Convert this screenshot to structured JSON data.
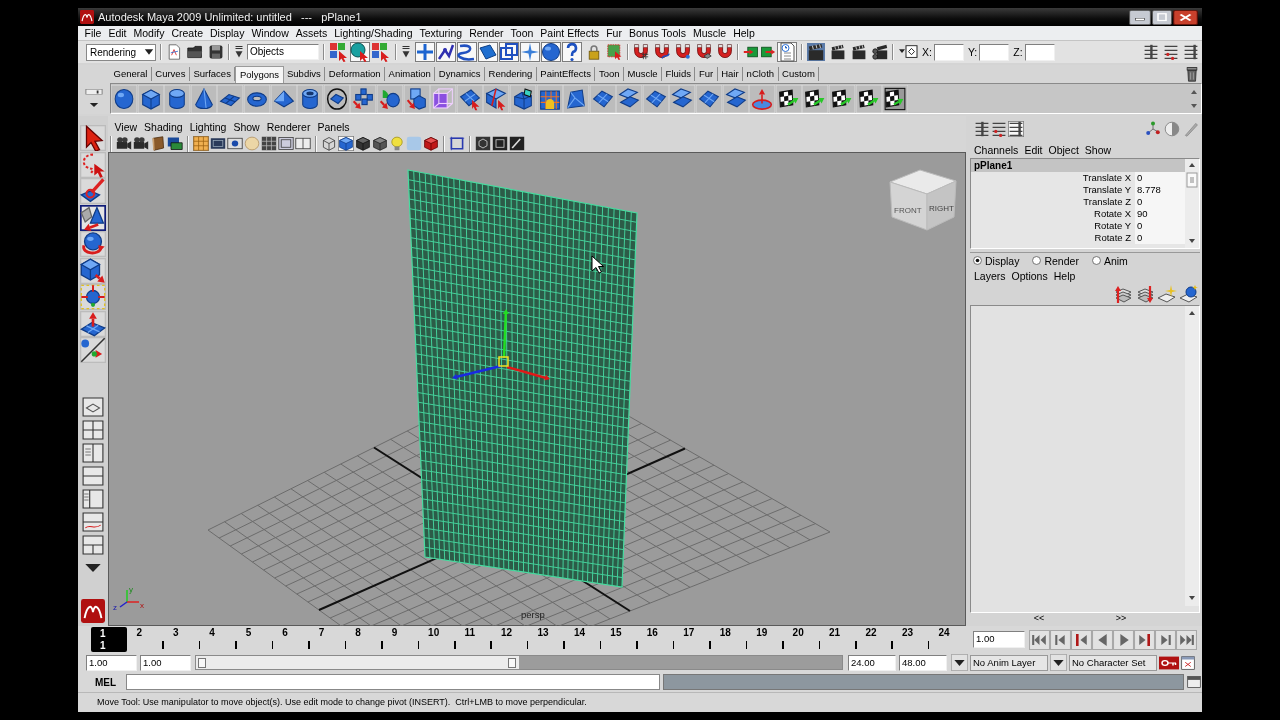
{
  "window": {
    "title": "Autodesk Maya 2009 Unlimited: untitled   ---   pPlane1"
  },
  "menu_bar": [
    "File",
    "Edit",
    "Modify",
    "Create",
    "Display",
    "Window",
    "Assets",
    "Lighting/Shading",
    "Texturing",
    "Render",
    "Toon",
    "Paint Effects",
    "Fur",
    "Bonus Tools",
    "Muscle",
    "Help"
  ],
  "status_line": {
    "menu_set": "Rendering",
    "selection_mode": "Objects",
    "mode_buttons": [
      {
        "selected": false
      },
      {
        "selected": true
      },
      {
        "selected": false
      }
    ],
    "mask_buttons": [
      {
        "on": true
      },
      {
        "on": true
      },
      {
        "on": true
      },
      {
        "on": true
      },
      {
        "on": true
      },
      {
        "on": true
      },
      {
        "on": true
      },
      {
        "on": true
      }
    ],
    "history": {
      "on": true
    },
    "coordinate_labels": [
      "X:",
      "Y:",
      "Z:"
    ]
  },
  "shelf": {
    "tabs": [
      {
        "label": "General",
        "selected": false
      },
      {
        "label": "Curves",
        "selected": false
      },
      {
        "label": "Surfaces",
        "selected": false
      },
      {
        "label": "Polygons",
        "selected": true
      },
      {
        "label": "Subdivs",
        "selected": false
      },
      {
        "label": "Deformation",
        "selected": false
      },
      {
        "label": "Animation",
        "selected": false
      },
      {
        "label": "Dynamics",
        "selected": false
      },
      {
        "label": "Rendering",
        "selected": false
      },
      {
        "label": "PaintEffects",
        "selected": false
      },
      {
        "label": "Toon",
        "selected": false
      },
      {
        "label": "Muscle",
        "selected": false
      },
      {
        "label": "Fluids",
        "selected": false
      },
      {
        "label": "Fur",
        "selected": false
      },
      {
        "label": "Hair",
        "selected": false
      },
      {
        "label": "nCloth",
        "selected": false
      },
      {
        "label": "Custom",
        "selected": false
      }
    ]
  },
  "tool_box": {
    "tools": [
      {
        "selected": false
      },
      {
        "selected": false
      },
      {
        "selected": false
      },
      {
        "selected": true
      },
      {
        "selected": false
      },
      {
        "selected": false
      },
      {
        "selected": false
      },
      {
        "selected": false
      },
      {
        "selected": false
      }
    ]
  },
  "viewport": {
    "menus": [
      "View",
      "Shading",
      "Lighting",
      "Show",
      "Renderer",
      "Panels"
    ],
    "icon_toggles": [
      {
        "on": false
      },
      {
        "on": false
      },
      {
        "on": false
      },
      {
        "on": false
      },
      {
        "on": true
      },
      {
        "on": false
      },
      {
        "on": false
      },
      {
        "on": false
      },
      {
        "on": false
      },
      {
        "on": false
      },
      {
        "on": false
      },
      {
        "on": false
      },
      {
        "on": true
      },
      {
        "on": false
      },
      {
        "on": false
      },
      {
        "on": false
      },
      {
        "on": false
      },
      {
        "on": false
      },
      {
        "on": false
      },
      {
        "on": false
      },
      {
        "on": false
      },
      {
        "on": false
      }
    ],
    "view_cube_labels": [
      "FRONT",
      "RIGHT"
    ],
    "camera": "persp",
    "axis_labels": [
      "y",
      "z",
      "x"
    ]
  },
  "channel_box": {
    "icon_toggles": [
      {
        "on": false
      },
      {
        "on": false
      },
      {
        "on": true
      }
    ],
    "menus": [
      "Channels",
      "Edit",
      "Object",
      "Show"
    ],
    "object": "pPlane1",
    "channels": [
      {
        "name": "Translate X",
        "value": "0"
      },
      {
        "name": "Translate Y",
        "value": "8.778"
      },
      {
        "name": "Translate Z",
        "value": "0"
      },
      {
        "name": "Rotate X",
        "value": "90"
      },
      {
        "name": "Rotate Y",
        "value": "0"
      },
      {
        "name": "Rotate Z",
        "value": "0"
      }
    ]
  },
  "layer_editor": {
    "modes": [
      {
        "label": "Display",
        "selected": true
      },
      {
        "label": "Render",
        "selected": false
      },
      {
        "label": "Anim",
        "selected": false
      }
    ],
    "menus": [
      "Layers",
      "Options",
      "Help"
    ],
    "scroll_arrows": [
      "<<",
      ">>"
    ]
  },
  "time_slider": {
    "frames": [
      {
        "label": "1",
        "selected": true
      },
      {
        "label": "2",
        "selected": false
      },
      {
        "label": "3",
        "selected": false
      },
      {
        "label": "4",
        "selected": false
      },
      {
        "label": "5",
        "selected": false
      },
      {
        "label": "6",
        "selected": false
      },
      {
        "label": "7",
        "selected": false
      },
      {
        "label": "8",
        "selected": false
      },
      {
        "label": "9",
        "selected": false
      },
      {
        "label": "10",
        "selected": false
      },
      {
        "label": "11",
        "selected": false
      },
      {
        "label": "12",
        "selected": false
      },
      {
        "label": "13",
        "selected": false
      },
      {
        "label": "14",
        "selected": false
      },
      {
        "label": "15",
        "selected": false
      },
      {
        "label": "16",
        "selected": false
      },
      {
        "label": "17",
        "selected": false
      },
      {
        "label": "18",
        "selected": false
      },
      {
        "label": "19",
        "selected": false
      },
      {
        "label": "20",
        "selected": false
      },
      {
        "label": "21",
        "selected": false
      },
      {
        "label": "22",
        "selected": false
      },
      {
        "label": "23",
        "selected": false
      },
      {
        "label": "24",
        "selected": false
      }
    ],
    "current_frame": "1",
    "current_time": "1.00"
  },
  "range_slider": {
    "start_time": "1.00",
    "playback_start": "1.00",
    "level": 0.5,
    "playback_end": "24.00",
    "end_time": "48.00",
    "anim_layer": "No Anim Layer",
    "character_set": "No Character Set"
  },
  "command_line": {
    "label": "MEL"
  },
  "help_line": "Move Tool: Use manipulator to move object(s). Use edit mode to change pivot (INSERT).  Ctrl+LMB to move perpendicular."
}
